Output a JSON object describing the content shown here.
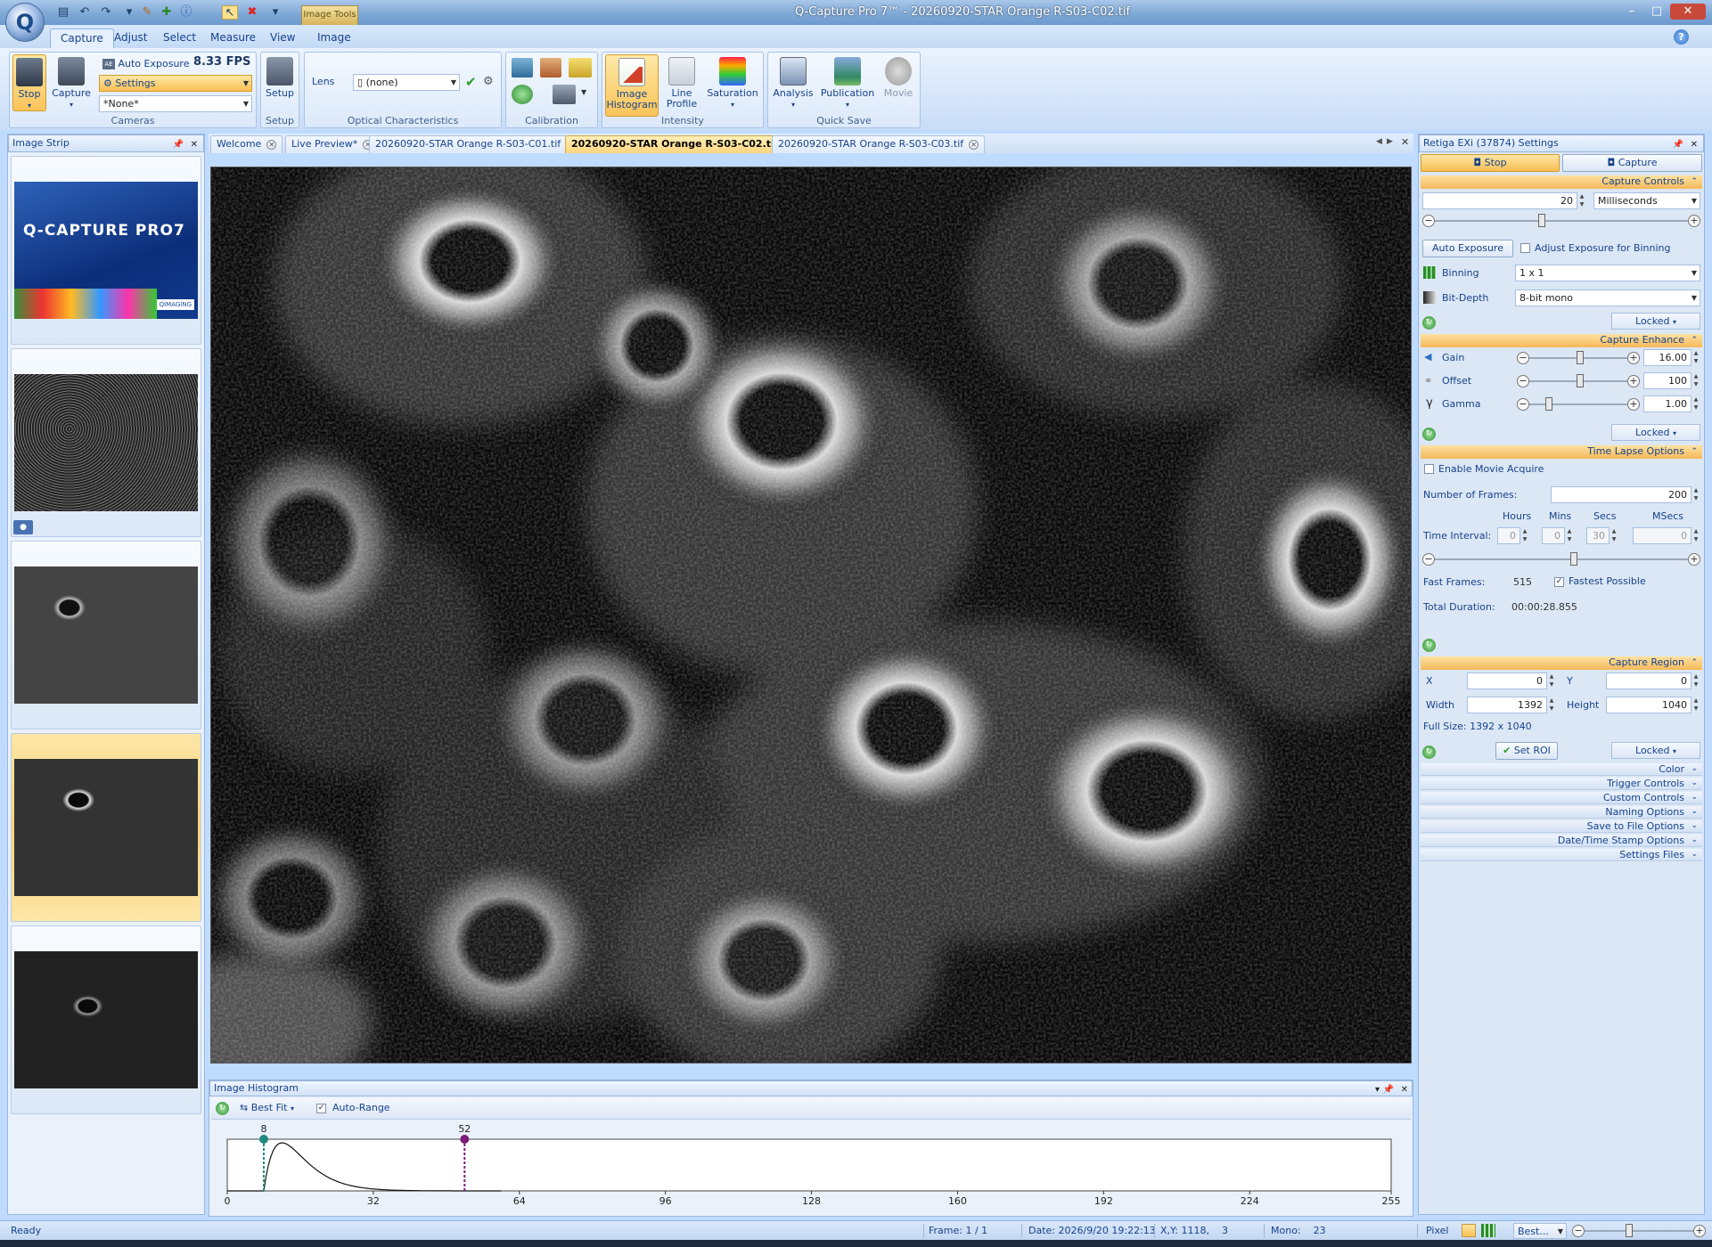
{
  "window": {
    "title": "Q-Capture Pro 7™ - 20260920-STAR Orange R-S03-C02.tif",
    "contextual_tab": "Image Tools",
    "app_button": "Q",
    "controls": {
      "minimize": "–",
      "maximize": "□",
      "close": "✕"
    }
  },
  "ribbon": {
    "tabs": [
      "Capture",
      "Adjust",
      "Select",
      "Measure",
      "View",
      "Image"
    ],
    "active_tab": "Capture",
    "cameras": {
      "stop": "Stop",
      "capture": "Capture",
      "auto_exposure": "Auto Exposure",
      "fps": "8.33 FPS",
      "settings": "Settings",
      "preset": "*None*",
      "label": "Cameras"
    },
    "setup": {
      "button": "Setup",
      "label": "Setup"
    },
    "optical": {
      "lens_label": "Lens",
      "lens_value": "(none)",
      "label": "Optical Characteristics"
    },
    "calibration": {
      "label": "Calibration"
    },
    "intensity": {
      "histogram": [
        "Image",
        "Histogram"
      ],
      "line_profile": [
        "Line",
        "Profile"
      ],
      "saturation": "Saturation",
      "label": "Intensity"
    },
    "quick_save": {
      "analysis": "Analysis",
      "publication": "Publication",
      "movie": "Movie",
      "label": "Quick Save"
    }
  },
  "image_strip": {
    "title": "Image Strip",
    "logo_text": "Q-CAPTURE PRO7",
    "logo_badge": "QIMAGING"
  },
  "doc_tabs": [
    "Welcome",
    "Live Preview*",
    "20260920-STAR Orange R-S03-C01.tif",
    "20260920-STAR Orange R-S03-C02.tif",
    "20260920-STAR Orange R-S03-C03.tif"
  ],
  "active_doc_tab": 3,
  "histogram": {
    "title": "Image Histogram",
    "best_fit": "Best Fit",
    "auto_range": "Auto-Range",
    "low_marker": 8,
    "high_marker": 52,
    "low_label": "8",
    "high_label": "52",
    "x_ticks": [
      "0",
      "32",
      "64",
      "96",
      "128",
      "160",
      "192",
      "224",
      "255"
    ],
    "x_min": 0,
    "x_max": 255,
    "curve_peak": 12
  },
  "settings_panel": {
    "title": "Retiga EXi (37874) Settings",
    "stop_tab": "Stop",
    "capture_tab": "Capture",
    "capture_controls": {
      "header": "Capture Controls",
      "exposure_value": "20",
      "exposure_unit": "Milliseconds",
      "exposure_slider": 0.42,
      "auto_exposure": "Auto Exposure",
      "adjust_binning": "Adjust Exposure for Binning",
      "binning_label": "Binning",
      "binning_value": "1 x 1",
      "bitdepth_label": "Bit-Depth",
      "bitdepth_value": "8-bit mono",
      "locked": "Locked"
    },
    "capture_enhance": {
      "header": "Capture Enhance",
      "gain_label": "Gain",
      "gain_value": "16.00",
      "gain_slider": 0.52,
      "offset_label": "Offset",
      "offset_value": "100",
      "offset_slider": 0.52,
      "gamma_label": "Gamma",
      "gamma_value": "1.00",
      "gamma_slider": 0.18,
      "locked": "Locked"
    },
    "time_lapse": {
      "header": "Time Lapse Options",
      "enable_movie": "Enable Movie Acquire",
      "frames_label": "Number of Frames:",
      "frames_value": "200",
      "col_hours": "Hours",
      "col_mins": "Mins",
      "col_secs": "Secs",
      "col_msecs": "MSecs",
      "interval_label": "Time Interval:",
      "hours": "0",
      "mins": "0",
      "secs": "30",
      "msecs": "0",
      "interval_slider": 0.55,
      "fast_frames_label": "Fast Frames:",
      "fast_frames_value": "515",
      "fastest_possible": "Fastest Possible",
      "total_duration_label": "Total Duration:",
      "total_duration_value": "00:00:28.855"
    },
    "capture_region": {
      "header": "Capture Region",
      "x_label": "X",
      "x_value": "0",
      "y_label": "Y",
      "y_value": "0",
      "width_label": "Width",
      "width_value": "1392",
      "height_label": "Height",
      "height_value": "1040",
      "full_size": "Full Size: 1392 x 1040",
      "set_roi": "Set ROI",
      "locked": "Locked"
    },
    "collapsed_sections": [
      "Color",
      "Trigger Controls",
      "Custom Controls",
      "Naming Options",
      "Save to File Options",
      "Date/Time Stamp Options",
      "Settings Files"
    ]
  },
  "status_bar": {
    "ready": "Ready",
    "frame": "Frame: 1 / 1",
    "date": "Date: 2026/9/20 19:22:13",
    "xy": "X,Y: 1118,    3",
    "mono": "Mono:    23",
    "pixel": "Pixel",
    "zoom": "Best..."
  }
}
